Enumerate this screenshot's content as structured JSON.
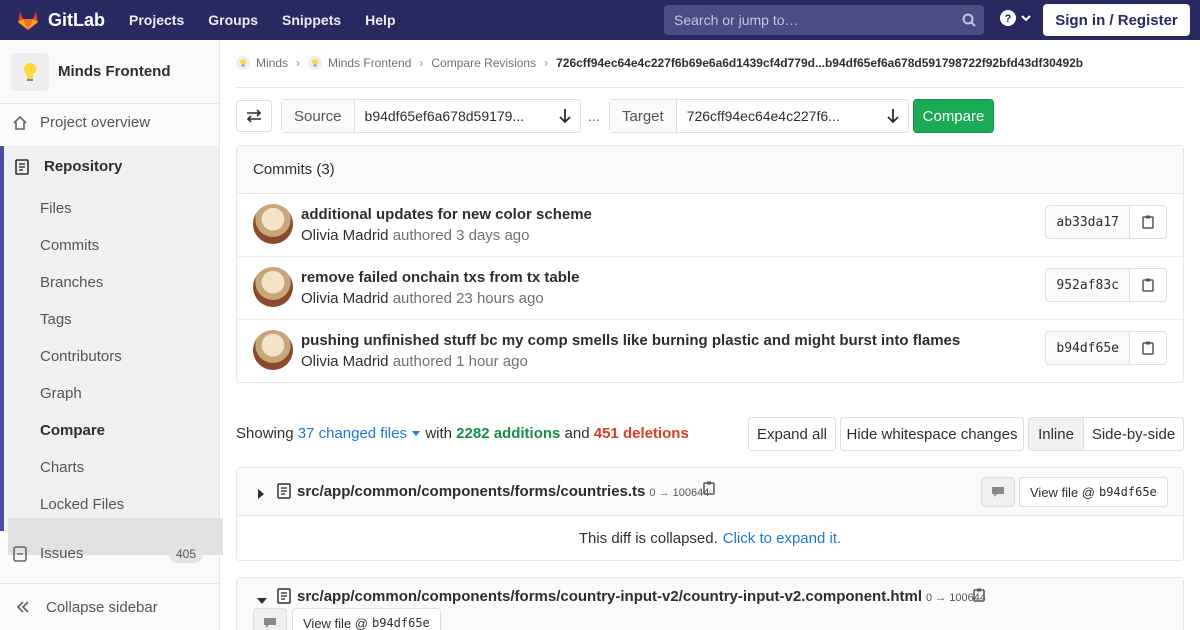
{
  "navbar": {
    "brand": "GitLab",
    "links": [
      "Projects",
      "Groups",
      "Snippets",
      "Help"
    ],
    "search_placeholder": "Search or jump to…",
    "signin": "Sign in / Register"
  },
  "sidebar": {
    "project_name": "Minds Frontend",
    "overview": "Project overview",
    "repository": "Repository",
    "repo_items": [
      "Files",
      "Commits",
      "Branches",
      "Tags",
      "Contributors",
      "Graph",
      "Compare",
      "Charts",
      "Locked Files"
    ],
    "issues": "Issues",
    "issues_count": "405",
    "collapse": "Collapse sidebar"
  },
  "breadcrumbs": {
    "items": [
      "Minds",
      "Minds Frontend",
      "Compare Revisions"
    ],
    "current": "726cff94ec64e4c227f6b69e6a6d1439cf4d779d...b94df65ef6a678d591798722f92bfd43df30492b"
  },
  "compare": {
    "source_label": "Source",
    "source_value": "b94df65ef6a678d59179...",
    "target_label": "Target",
    "target_value": "726cff94ec64e4c227f6...",
    "ellipsis": "...",
    "button": "Compare"
  },
  "commits": {
    "header": "Commits (3)",
    "items": [
      {
        "title": "additional updates for new color scheme",
        "author": "Olivia Madrid",
        "time": "authored 3 days ago",
        "sha": "ab33da17"
      },
      {
        "title": "remove failed onchain txs from tx table",
        "author": "Olivia Madrid",
        "time": "authored 23 hours ago",
        "sha": "952af83c"
      },
      {
        "title": "pushing unfinished stuff bc my comp smells like burning plastic and might burst into flames",
        "author": "Olivia Madrid",
        "time": "authored 1 hour ago",
        "sha": "b94df65e"
      }
    ]
  },
  "summary": {
    "showing": "Showing",
    "changed": "37 changed files",
    "with": "with",
    "additions": "2282 additions",
    "and": "and",
    "deletions": "451 deletions"
  },
  "toolbar": {
    "expand_all": "Expand all",
    "hide_ws": "Hide whitespace changes",
    "inline": "Inline",
    "side_by_side": "Side-by-side"
  },
  "files": [
    {
      "path": "src/app/common/components/forms/countries.ts",
      "mode": "0 → 100644",
      "view_label": "View file @",
      "view_sha": "b94df65e",
      "collapsed_text": "This diff is collapsed.",
      "expand_link": "Click to expand it."
    },
    {
      "path": "src/app/common/components/forms/country-input-v2/country-input-v2.component.html",
      "mode": "0 → 100644",
      "view_label": "View file @",
      "view_sha": "b94df65e"
    }
  ],
  "colors": {
    "navbar": "#292961",
    "accent": "#1f78d1",
    "success": "#1aaa55",
    "danger": "#db3b21",
    "sidebar_active_border": "#4b4ba3"
  }
}
